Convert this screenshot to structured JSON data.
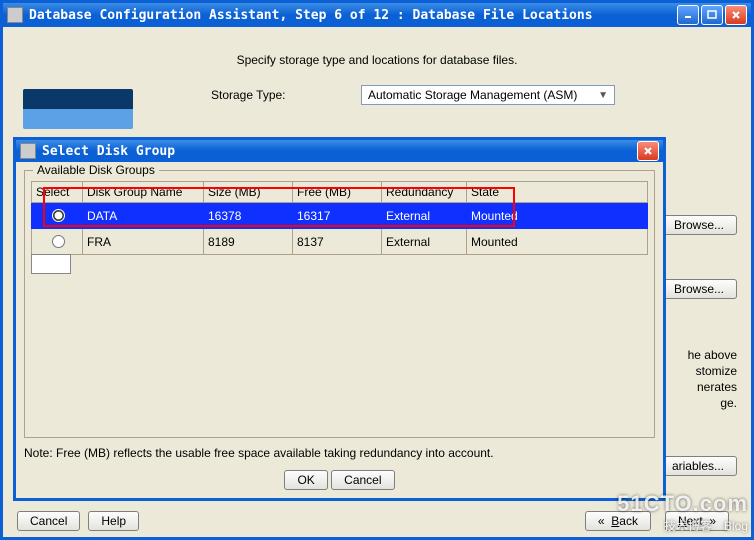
{
  "main_window": {
    "title": "Database Configuration Assistant, Step 6 of 12 : Database File Locations",
    "instruct": "Specify storage type and locations for database files.",
    "storage_type_label": "Storage Type:",
    "storage_type_value": "Automatic Storage Management (ASM)",
    "buttons": {
      "browse": "Browse...",
      "variables": "ariables...",
      "cancel": "Cancel",
      "help": "Help",
      "back": "Back",
      "next": "Next"
    },
    "peek_text": [
      "he above",
      "stomize",
      "nerates",
      "ge."
    ]
  },
  "dialog": {
    "title": "Select Disk Group",
    "legend": "Available Disk Groups",
    "columns": [
      "Select",
      "Disk Group Name",
      "Size (MB)",
      "Free (MB)",
      "Redundancy",
      "State"
    ],
    "rows": [
      {
        "selected": true,
        "name": "DATA",
        "size": "16378",
        "free": "16317",
        "redundancy": "External",
        "state": "Mounted"
      },
      {
        "selected": false,
        "name": "FRA",
        "size": "8189",
        "free": "8137",
        "redundancy": "External",
        "state": "Mounted"
      }
    ],
    "note": "Note:  Free (MB) reflects the usable free space available taking redundancy into account.",
    "ok": "OK",
    "cancel": "Cancel"
  },
  "watermark": {
    "big": "51CTO.com",
    "small": "技术博客　Blog"
  }
}
